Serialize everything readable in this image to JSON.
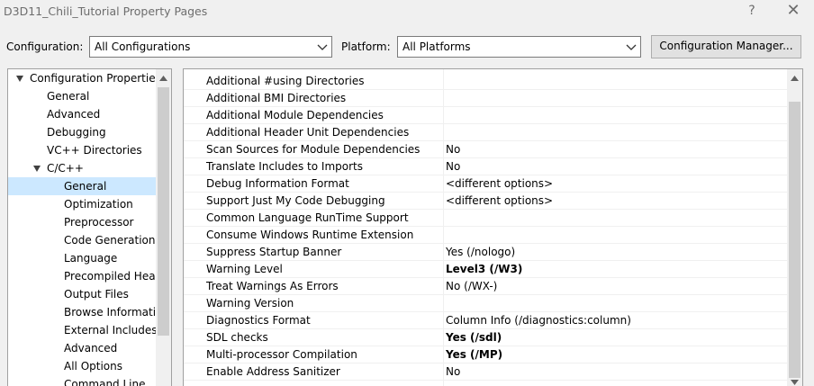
{
  "window": {
    "title": "D3D11_Chili_Tutorial Property Pages",
    "help_label": "?",
    "close_label": "✕"
  },
  "config": {
    "configuration_label": "Configuration:",
    "configuration_value": "All Configurations",
    "platform_label": "Platform:",
    "platform_value": "All Platforms",
    "manager_label": "Configuration Manager..."
  },
  "tree": {
    "items": [
      {
        "label": "Configuration Properties"
      },
      {
        "label": "General"
      },
      {
        "label": "Advanced"
      },
      {
        "label": "Debugging"
      },
      {
        "label": "VC++ Directories"
      },
      {
        "label": "C/C++"
      },
      {
        "label": "General"
      },
      {
        "label": "Optimization"
      },
      {
        "label": "Preprocessor"
      },
      {
        "label": "Code Generation"
      },
      {
        "label": "Language"
      },
      {
        "label": "Precompiled Headers"
      },
      {
        "label": "Output Files"
      },
      {
        "label": "Browse Information"
      },
      {
        "label": "External Includes"
      },
      {
        "label": "Advanced"
      },
      {
        "label": "All Options"
      },
      {
        "label": "Command Line"
      }
    ]
  },
  "properties": [
    {
      "name": "Additional #using Directories",
      "value": ""
    },
    {
      "name": "Additional BMI Directories",
      "value": ""
    },
    {
      "name": "Additional Module Dependencies",
      "value": ""
    },
    {
      "name": "Additional Header Unit Dependencies",
      "value": ""
    },
    {
      "name": "Scan Sources for Module Dependencies",
      "value": "No"
    },
    {
      "name": "Translate Includes to Imports",
      "value": "No"
    },
    {
      "name": "Debug Information Format",
      "value": "<different options>"
    },
    {
      "name": "Support Just My Code Debugging",
      "value": "<different options>"
    },
    {
      "name": "Common Language RunTime Support",
      "value": ""
    },
    {
      "name": "Consume Windows Runtime Extension",
      "value": ""
    },
    {
      "name": "Suppress Startup Banner",
      "value": "Yes (/nologo)"
    },
    {
      "name": "Warning Level",
      "value": "Level3 (/W3)"
    },
    {
      "name": "Treat Warnings As Errors",
      "value": "No (/WX-)"
    },
    {
      "name": "Warning Version",
      "value": ""
    },
    {
      "name": "Diagnostics Format",
      "value": "Column Info (/diagnostics:column)"
    },
    {
      "name": "SDL checks",
      "value": "Yes (/sdl)"
    },
    {
      "name": "Multi-processor Compilation",
      "value": "Yes (/MP)"
    },
    {
      "name": "Enable Address Sanitizer",
      "value": "No"
    }
  ],
  "colors": {
    "selection": "#cce8ff",
    "window_bg": "#f0f0f0",
    "title_text": "#6d6d6d"
  }
}
